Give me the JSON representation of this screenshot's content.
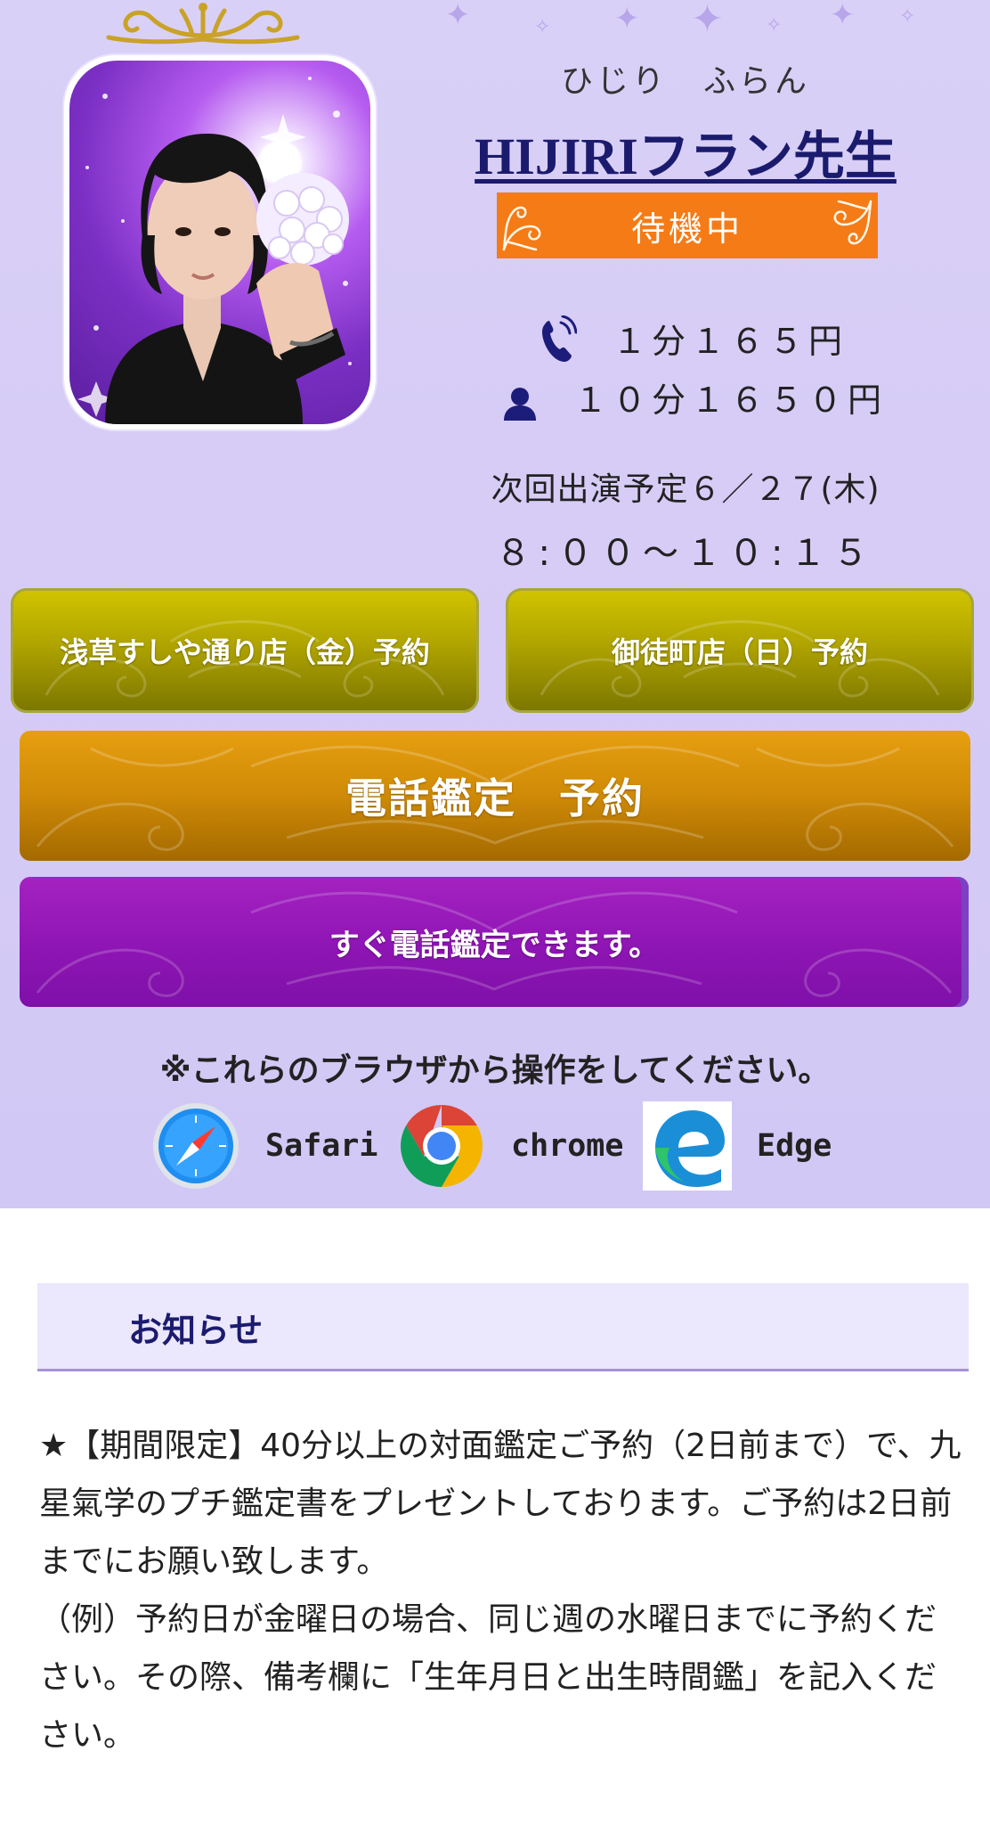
{
  "profile": {
    "reading": "ひじり　ふらん",
    "name": "HIJIRIフラン先生",
    "status": "待機中",
    "price_per_minute": "１分１６５円",
    "price_ten_minutes": "１０分１６５０円",
    "next_schedule_label": "次回出演予定６／２７(木)",
    "next_schedule_time": "８:００〜１０:１５"
  },
  "buttons": {
    "asakusa": "浅草すしや通り店（金）予約",
    "okachimachi": "御徒町店（日）予約",
    "phone_reservation": "電話鑑定　予約",
    "phone_now": "すぐ電話鑑定できます。"
  },
  "browsers": {
    "note": "※これらのブラウザから操作をしてください。",
    "items": [
      "Safari",
      "chrome",
      "Edge"
    ]
  },
  "notice": {
    "title": "お知らせ",
    "text": "★【期間限定】40分以上の対面鑑定ご予約（2日前まで）で、九星氣学のプチ鑑定書をプレゼントしております。ご予約は2日前までにお願い致します。\n（例）予約日が金曜日の場合、同じ週の水曜日までに予約ください。その際、備考欄に「生年月日と出生時間鑑」を記入ください。"
  },
  "icons": {
    "phone": "phone-icon",
    "person": "person-icon",
    "safari": "safari-icon",
    "chrome": "chrome-icon",
    "edge": "edge-icon"
  },
  "colors": {
    "hero_background": "#d6ccf6",
    "status_badge": "#f57b16",
    "name_text": "#1b1b6e",
    "olive_button": "#b0a400",
    "orange_button": "#cf8a07",
    "purple_button": "#9016b5",
    "notice_bar": "#ebe7fc"
  }
}
